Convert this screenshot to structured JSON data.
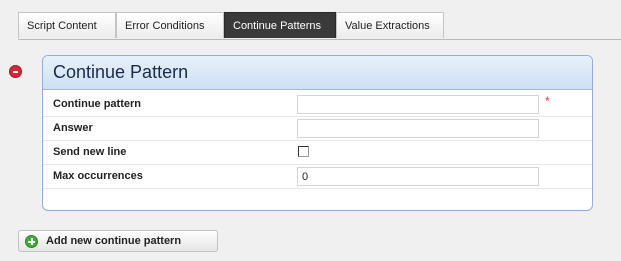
{
  "tabs": [
    {
      "label": "Script Content",
      "active": false
    },
    {
      "label": "Error Conditions",
      "active": false
    },
    {
      "label": "Continue Patterns",
      "active": true
    },
    {
      "label": "Value Extractions",
      "active": false
    }
  ],
  "panel": {
    "title": "Continue Pattern",
    "fields": {
      "continue_pattern": {
        "label": "Continue pattern",
        "value": "",
        "required_mark": "*"
      },
      "answer": {
        "label": "Answer",
        "value": ""
      },
      "send_new_line": {
        "label": "Send new line",
        "checked": false
      },
      "max_occurrences": {
        "label": "Max occurrences",
        "value": "0"
      }
    }
  },
  "add_button": {
    "label": "Add new continue pattern"
  },
  "icons": {
    "remove": "remove-circle-icon",
    "add": "add-circle-icon"
  },
  "colors": {
    "active_tab": "#3a3a3a",
    "panel_header": "#cddff4",
    "remove_icon": "#d8263a",
    "add_icon": "#3cae38",
    "required_mark": "#e43a3a"
  }
}
